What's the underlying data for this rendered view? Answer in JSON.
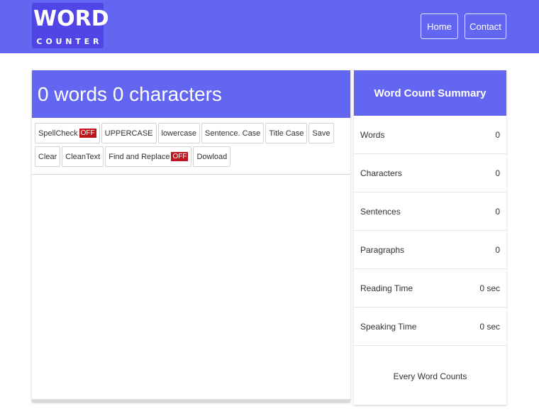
{
  "logo": {
    "main_letters": [
      "W",
      "O",
      "R",
      "D"
    ],
    "sub_letters": [
      "C",
      "O",
      "U",
      "N",
      "T",
      "E",
      "R"
    ]
  },
  "nav": {
    "home": "Home",
    "contact": "Contact"
  },
  "editor": {
    "heading": "0 words 0 characters",
    "toolbar": {
      "spellcheck": "SpellCheck",
      "spellcheck_state": "OFF",
      "uppercase": "UPPERCASE",
      "lowercase": "lowercase",
      "sentence_case": "Sentence. Case",
      "title_case": "Title Case",
      "save": "Save",
      "clear": "Clear",
      "clean_text": "CleanText",
      "find_replace": "Find and Replace",
      "find_replace_state": "OFF",
      "download": "Dowload"
    },
    "text_value": ""
  },
  "summary": {
    "title": "Word Count Summary",
    "rows": [
      {
        "label": "Words",
        "value": "0"
      },
      {
        "label": "Characters",
        "value": "0"
      },
      {
        "label": "Sentences",
        "value": "0"
      },
      {
        "label": "Paragraphs",
        "value": "0"
      },
      {
        "label": "Reading Time",
        "value": "0 sec"
      },
      {
        "label": "Speaking Time",
        "value": "0 sec"
      }
    ],
    "footer": "Every Word Counts"
  },
  "colors": {
    "brand": "#6366f1",
    "badge_off": "#c0131c"
  }
}
